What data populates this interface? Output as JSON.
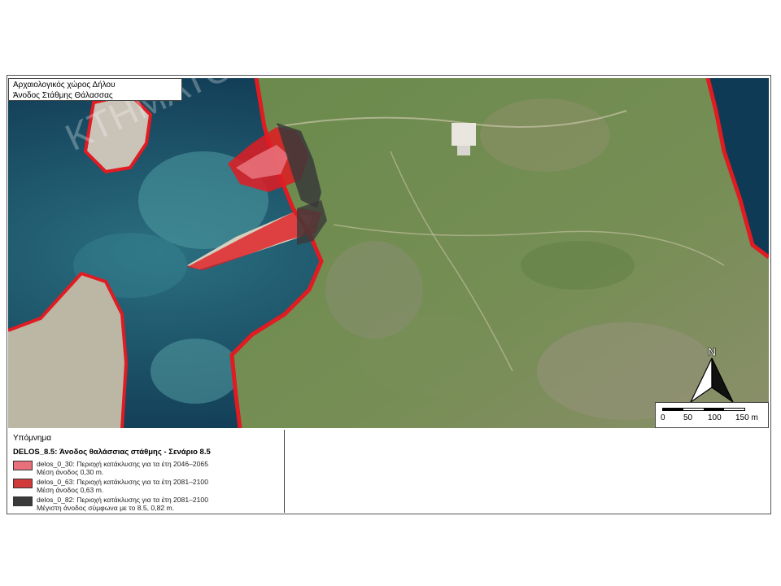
{
  "map_title": {
    "line1": "Αρχαιολογικός χώρος Δήλου",
    "line2": "Άνοδος Στάθμης Θάλασσας"
  },
  "watermark": "ΚΤΗΜΑΤΟΛΟΓΙΟ",
  "legend": {
    "heading": "Υπόμνημα",
    "layer_title": "DELOS_8.5: Άνοδος θαλάσσιας στάθμης - Σενάριο 8.5",
    "items": [
      {
        "name": "delos_0_30:",
        "desc": "Περιοχή κατάκλυσης για τα έτη 2046–2065",
        "note": "Μέση άνοδος 0,30 m.",
        "color": "#e8707a"
      },
      {
        "name": "delos_0_63:",
        "desc": "Περιοχή κατάκλυσης για τα έτη 2081–2100",
        "note": "Μέση άνοδος 0,63 m.",
        "color": "#d23a3a"
      },
      {
        "name": "delos_0_82:",
        "desc": "Περιοχή κατάκλυσης για τα έτη 2081–2100",
        "note": "Μέγιστη άνοδος σύμφωνα με το 8.5, 0,82 m.",
        "color": "#3a3a3a"
      }
    ]
  },
  "north_arrow": {
    "label": "N"
  },
  "scale_bar": {
    "labels": [
      "0",
      "50",
      "100",
      "150 m"
    ]
  },
  "colors": {
    "sea_deep": "#0f3f5c",
    "sea_shallow": "#3c8c9a",
    "land": "#6f8a4e",
    "flood": "#e01b22"
  }
}
